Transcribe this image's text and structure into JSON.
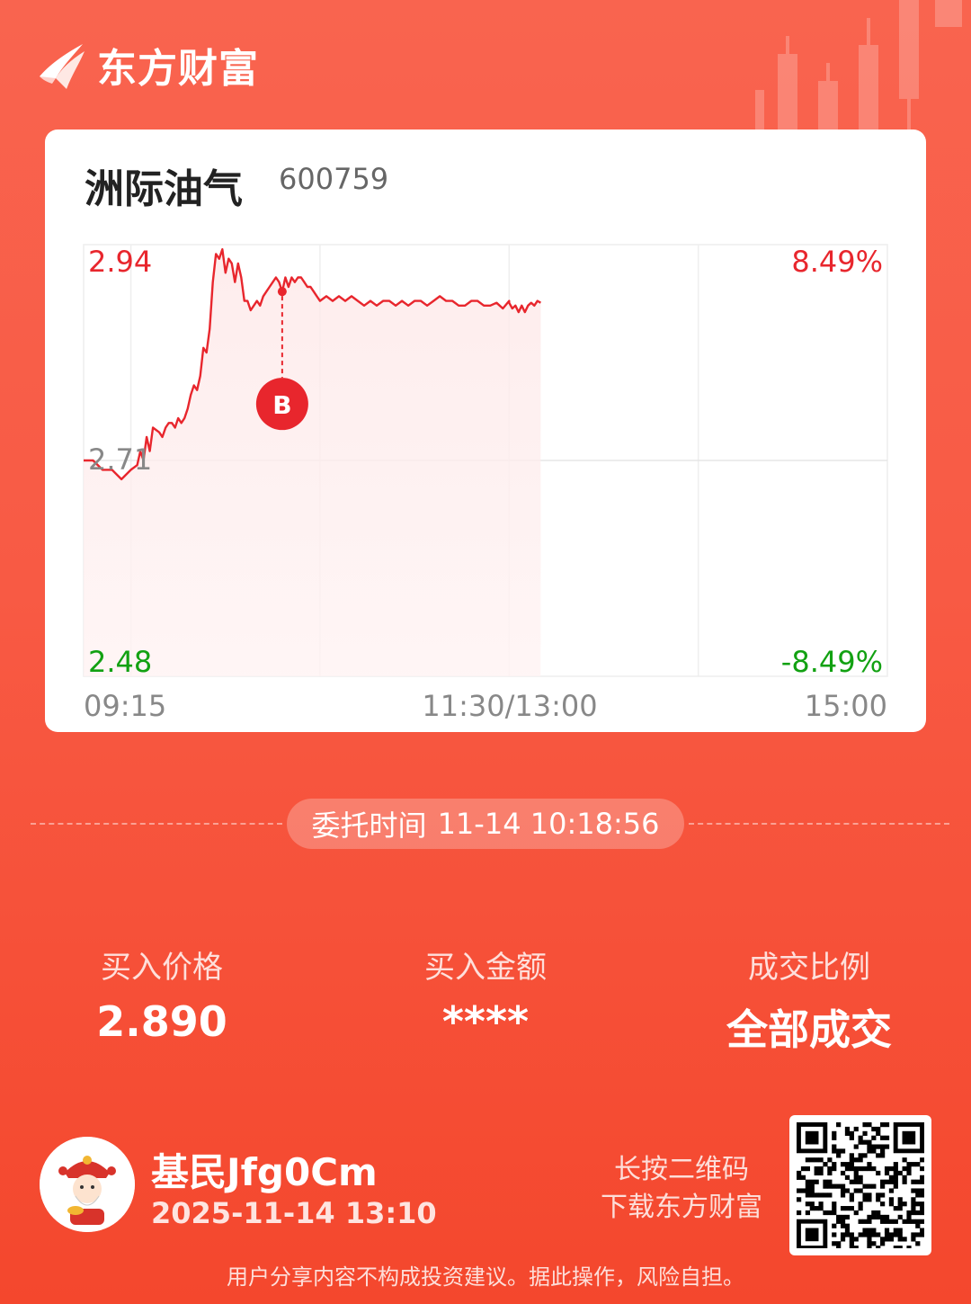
{
  "brand": {
    "name": "东方财富",
    "logo_icon": "eastmoney-logo-icon"
  },
  "stock": {
    "name": "洲际油气",
    "code": "600759"
  },
  "chart_data": {
    "type": "line",
    "title": "",
    "prev_close": 2.71,
    "ylim": [
      2.48,
      2.94
    ],
    "y_labels": {
      "top": "2.94",
      "mid": "2.71",
      "bottom": "2.48"
    },
    "pct_labels": {
      "top": "8.49%",
      "bottom": "-8.49%"
    },
    "x_labels": [
      "09:15",
      "11:30/13:00",
      "15:00"
    ],
    "series": [
      {
        "points": [
          [
            "09:15",
            2.71
          ],
          [
            "09:18",
            2.71
          ],
          [
            "09:21",
            2.7
          ],
          [
            "09:24",
            2.7
          ],
          [
            "09:27",
            2.69
          ],
          [
            "09:30",
            2.7
          ],
          [
            "09:32",
            2.705
          ],
          [
            "09:33",
            2.72
          ],
          [
            "09:34",
            2.71
          ],
          [
            "09:35",
            2.735
          ],
          [
            "09:36",
            2.72
          ],
          [
            "09:37",
            2.745
          ],
          [
            "09:39",
            2.74
          ],
          [
            "09:40",
            2.735
          ],
          [
            "09:41",
            2.745
          ],
          [
            "09:42",
            2.75
          ],
          [
            "09:43",
            2.75
          ],
          [
            "09:44",
            2.745
          ],
          [
            "09:45",
            2.755
          ],
          [
            "09:46",
            2.75
          ],
          [
            "09:47",
            2.755
          ],
          [
            "09:48",
            2.765
          ],
          [
            "09:49",
            2.78
          ],
          [
            "09:50",
            2.79
          ],
          [
            "09:51",
            2.785
          ],
          [
            "09:52",
            2.8
          ],
          [
            "09:53",
            2.83
          ],
          [
            "09:54",
            2.825
          ],
          [
            "09:55",
            2.85
          ],
          [
            "09:56",
            2.9
          ],
          [
            "09:57",
            2.93
          ],
          [
            "09:58",
            2.925
          ],
          [
            "09:59",
            2.935
          ],
          [
            "10:00",
            2.91
          ],
          [
            "10:01",
            2.925
          ],
          [
            "10:02",
            2.92
          ],
          [
            "10:03",
            2.9
          ],
          [
            "10:04",
            2.92
          ],
          [
            "10:05",
            2.905
          ],
          [
            "10:06",
            2.88
          ],
          [
            "10:07",
            2.88
          ],
          [
            "10:08",
            2.87
          ],
          [
            "10:09",
            2.875
          ],
          [
            "10:10",
            2.88
          ],
          [
            "10:11",
            2.875
          ],
          [
            "10:12",
            2.885
          ],
          [
            "10:13",
            2.89
          ],
          [
            "10:14",
            2.895
          ],
          [
            "10:15",
            2.9
          ],
          [
            "10:16",
            2.905
          ],
          [
            "10:17",
            2.9
          ],
          [
            "10:18",
            2.89
          ],
          [
            "10:19",
            2.905
          ],
          [
            "10:20",
            2.895
          ],
          [
            "10:21",
            2.905
          ],
          [
            "10:22",
            2.9
          ],
          [
            "10:23",
            2.905
          ],
          [
            "10:24",
            2.905
          ],
          [
            "10:25",
            2.9
          ],
          [
            "10:26",
            2.895
          ],
          [
            "10:27",
            2.895
          ],
          [
            "10:28",
            2.89
          ],
          [
            "10:29",
            2.885
          ],
          [
            "10:30",
            2.88
          ],
          [
            "10:32",
            2.885
          ],
          [
            "10:34",
            2.88
          ],
          [
            "10:36",
            2.885
          ],
          [
            "10:38",
            2.88
          ],
          [
            "10:40",
            2.885
          ],
          [
            "10:42",
            2.88
          ],
          [
            "10:44",
            2.875
          ],
          [
            "10:46",
            2.88
          ],
          [
            "10:48",
            2.875
          ],
          [
            "10:50",
            2.88
          ],
          [
            "10:52",
            2.88
          ],
          [
            "10:54",
            2.875
          ],
          [
            "10:56",
            2.88
          ],
          [
            "10:58",
            2.875
          ],
          [
            "11:00",
            2.88
          ],
          [
            "11:02",
            2.88
          ],
          [
            "11:04",
            2.875
          ],
          [
            "11:06",
            2.88
          ],
          [
            "11:08",
            2.885
          ],
          [
            "11:10",
            2.88
          ],
          [
            "11:12",
            2.88
          ],
          [
            "11:14",
            2.875
          ],
          [
            "11:16",
            2.875
          ],
          [
            "11:18",
            2.88
          ],
          [
            "11:20",
            2.88
          ],
          [
            "11:22",
            2.875
          ],
          [
            "11:24",
            2.875
          ],
          [
            "11:26",
            2.878
          ],
          [
            "11:28",
            2.872
          ],
          [
            "11:30",
            2.88
          ],
          [
            "13:00",
            2.878
          ],
          [
            "13:01",
            2.872
          ],
          [
            "13:02",
            2.875
          ],
          [
            "13:03",
            2.868
          ],
          [
            "13:04",
            2.875
          ],
          [
            "13:05",
            2.868
          ],
          [
            "13:06",
            2.875
          ],
          [
            "13:07",
            2.878
          ],
          [
            "13:08",
            2.875
          ],
          [
            "13:09",
            2.88
          ],
          [
            "13:10",
            2.878
          ]
        ]
      }
    ],
    "markers": [
      {
        "label": "B",
        "time": "10:18",
        "price": 2.89
      }
    ],
    "grid": true
  },
  "entrust": {
    "label": "委托时间",
    "value": "11-14 10:18:56"
  },
  "stats": [
    {
      "label": "买入价格",
      "value": "2.890"
    },
    {
      "label": "买入金额",
      "value": "****"
    },
    {
      "label": "成交比例",
      "value": "全部成交"
    }
  ],
  "user": {
    "name": "基民Jfg0Cm",
    "time": "2025-11-14 13:10",
    "avatar_icon": "god-of-wealth-avatar-icon"
  },
  "qr": {
    "hint_line1": "长按二维码",
    "hint_line2": "下载东方财富",
    "icon": "qr-code-icon"
  },
  "disclaimer": "用户分享内容不构成投资建议。据此操作，风险自担。",
  "colors": {
    "up": "#e8262d",
    "down": "#12a112",
    "accent": "#f85a44"
  }
}
